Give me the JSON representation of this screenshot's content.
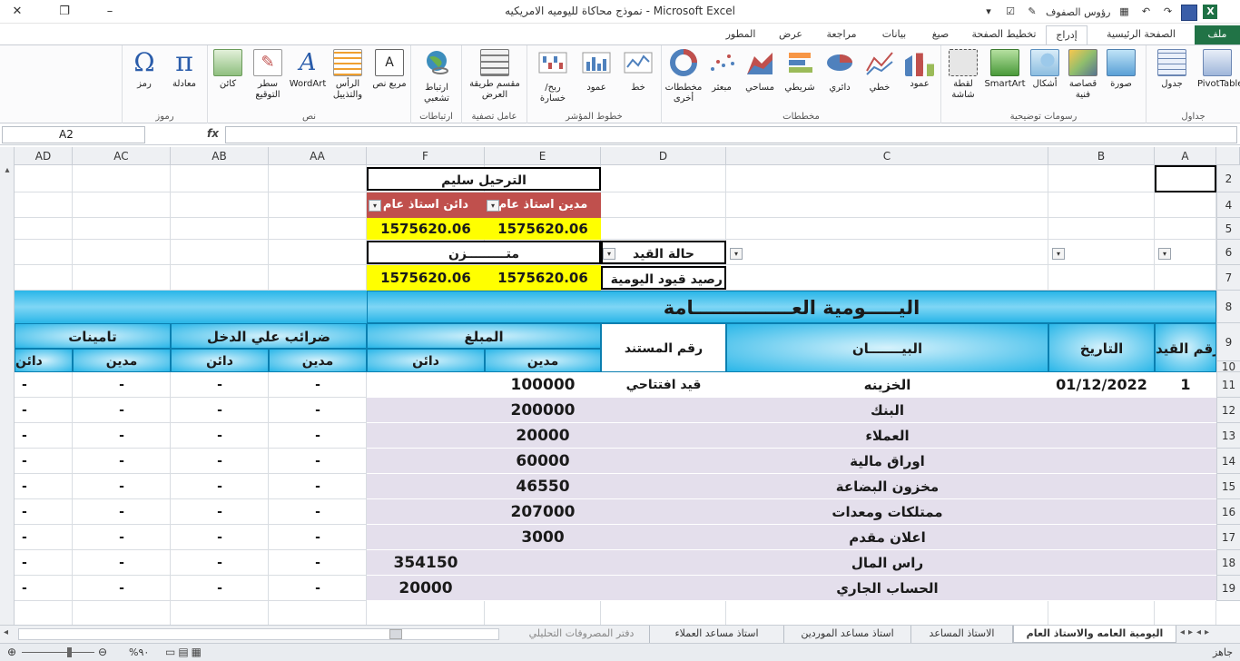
{
  "window": {
    "title": "نموذج محاكاة لليوميه الامريكيه - Microsoft Excel",
    "qat_label": "رؤوس الصفوف",
    "minimize": "–",
    "restore": "❐",
    "close": "✕"
  },
  "tabs": {
    "file": "ملف",
    "home": "الصفحة الرئيسية",
    "insert": "إدراج",
    "layout": "تخطيط الصفحة",
    "formulas": "صيغ",
    "data": "بيانات",
    "review": "مراجعة",
    "view": "عرض",
    "developer": "المطور"
  },
  "ribbon": {
    "groups": {
      "tables": "جداول",
      "illustrations": "رسومات توضيحية",
      "charts": "مخططات",
      "sparklines": "خطوط المؤشر",
      "filter": "عامل تصفية",
      "links": "ارتباطات",
      "text": "نص",
      "symbols": "رموز"
    },
    "buttons": {
      "pivot": "PivotTable",
      "table": "جدول",
      "picture": "صورة",
      "clipart": "قصاصة فنية",
      "shapes": "أشكال",
      "smartart": "SmartArt",
      "screenshot": "لقطة شاشة",
      "column": "عمود",
      "line": "خطي",
      "pie": "دائري",
      "bar": "شريطي",
      "area": "مساحي",
      "scatter": "مبعثر",
      "other": "مخططات أخرى",
      "sp_line": "خط",
      "sp_column": "عمود",
      "sp_winloss": "ربح/خسارة",
      "slicer": "مقسم طريقة العرض",
      "hyperlink": "ارتباط تشعبي",
      "textbox": "مربع نص",
      "header": "الرأس والتذييل",
      "wordart": "WordArt",
      "signature": "سطر التوقيع",
      "object": "كائن",
      "equation": "معادلة",
      "symbol": "رمز"
    }
  },
  "formula_bar": {
    "name_box": "A2",
    "fx": "fx",
    "content": ""
  },
  "columns": [
    "AD",
    "AC",
    "AB",
    "AA",
    "F",
    "E",
    "D",
    "C",
    "B",
    "A"
  ],
  "rows": [
    "2",
    "4",
    "5",
    "6",
    "7",
    "8",
    "9",
    "10",
    "11",
    "12",
    "13",
    "14",
    "15",
    "16",
    "17",
    "18",
    "19"
  ],
  "top": {
    "posting_ok": "الترحيل سليم",
    "debit_gl": "مدين استاذ عام",
    "credit_gl": "دائن استاذ عام",
    "debit_gl_value": "1575620.06",
    "credit_gl_value": "1575620.06",
    "balanced": "متـــــــــزن",
    "entry_status": "حالة القيد",
    "journal_balance_label": "رصيد قيود اليومية",
    "journal_debit": "1575620.06",
    "journal_credit": "1575620.06"
  },
  "journal": {
    "title": "اليـــــومية العـــــــــــــــامة",
    "h_entry_no": "رقم القيد",
    "h_date": "التاريخ",
    "h_desc": "البيـــــــان",
    "h_doc": "رقم المستند",
    "h_amount": "المبلغ",
    "h_debit": "مدين",
    "h_credit": "دائن",
    "h_income_tax": "ضرائب علي الدخل",
    "h_insurance": "تامينات",
    "h_tax_debit": "مدين",
    "h_tax_credit": "دائن",
    "h_ins_debit": "مدين",
    "h_ins_credit": "دائن"
  },
  "entries": [
    {
      "no": "1",
      "date": "01/12/2022",
      "desc": "الخزينه",
      "doc": "قيد افتتاحي",
      "debit": "100000",
      "credit": ""
    },
    {
      "no": "",
      "date": "",
      "desc": "البنك",
      "doc": "",
      "debit": "200000",
      "credit": ""
    },
    {
      "no": "",
      "date": "",
      "desc": "العملاء",
      "doc": "",
      "debit": "20000",
      "credit": ""
    },
    {
      "no": "",
      "date": "",
      "desc": "اوراق مالية",
      "doc": "",
      "debit": "60000",
      "credit": ""
    },
    {
      "no": "",
      "date": "",
      "desc": "مخزون البضاعة",
      "doc": "",
      "debit": "46550",
      "credit": ""
    },
    {
      "no": "",
      "date": "",
      "desc": "ممتلكات ومعدات",
      "doc": "",
      "debit": "207000",
      "credit": ""
    },
    {
      "no": "",
      "date": "",
      "desc": "اعلان مقدم",
      "doc": "",
      "debit": "3000",
      "credit": ""
    },
    {
      "no": "",
      "date": "",
      "desc": "راس المال",
      "doc": "",
      "debit": "",
      "credit": "354150"
    },
    {
      "no": "",
      "date": "",
      "desc": "الحساب الجاري",
      "doc": "",
      "debit": "",
      "credit": "20000"
    }
  ],
  "dash": "-",
  "sheets": [
    "اليومية العامه والاستاذ العام",
    "الاستاذ المساعد",
    "استاذ مساعد الموردين",
    "استاذ مساعد العملاء",
    "دفتر المصروفات التحليلي"
  ],
  "status": {
    "ready": "جاهز",
    "zoom": "%٩٠"
  },
  "colors": {
    "accent_red": "#c0504d",
    "yellow": "#ffff00",
    "header_cyan": "#29b6e8",
    "row_lavender": "#e4dfec",
    "excel_green": "#217346"
  }
}
